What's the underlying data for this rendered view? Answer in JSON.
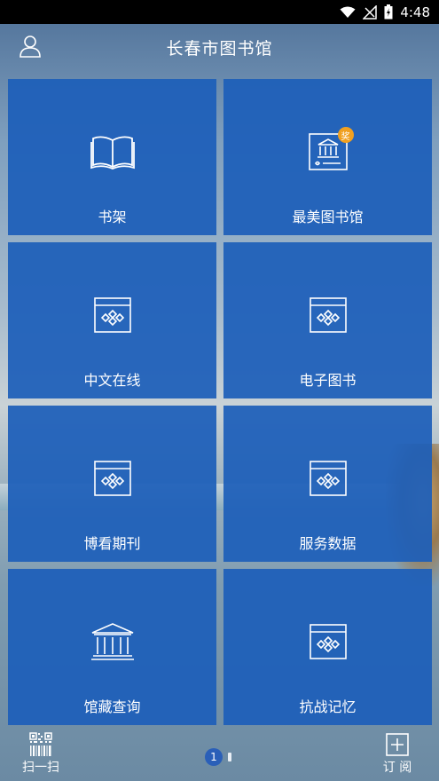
{
  "status": {
    "time": "4:48"
  },
  "header": {
    "title": "长春市图书馆",
    "user_icon": "user-icon"
  },
  "tiles": [
    {
      "label": "书架",
      "icon": "book-icon"
    },
    {
      "label": "最美图书馆",
      "icon": "library-award-icon",
      "badge": "奖"
    },
    {
      "label": "中文在线",
      "icon": "window-app-icon"
    },
    {
      "label": "电子图书",
      "icon": "window-app-icon"
    },
    {
      "label": "博看期刊",
      "icon": "window-app-icon"
    },
    {
      "label": "服务数据",
      "icon": "window-app-icon"
    },
    {
      "label": "馆藏查询",
      "icon": "library-building-icon"
    },
    {
      "label": "抗战记忆",
      "icon": "window-app-icon"
    }
  ],
  "bottom": {
    "scan_label": "扫一扫",
    "subscribe_label": "订 阅",
    "page_current": "1"
  },
  "colors": {
    "tile": "#1d5fb9",
    "badge": "#f0a020",
    "status_bar": "#000000"
  }
}
